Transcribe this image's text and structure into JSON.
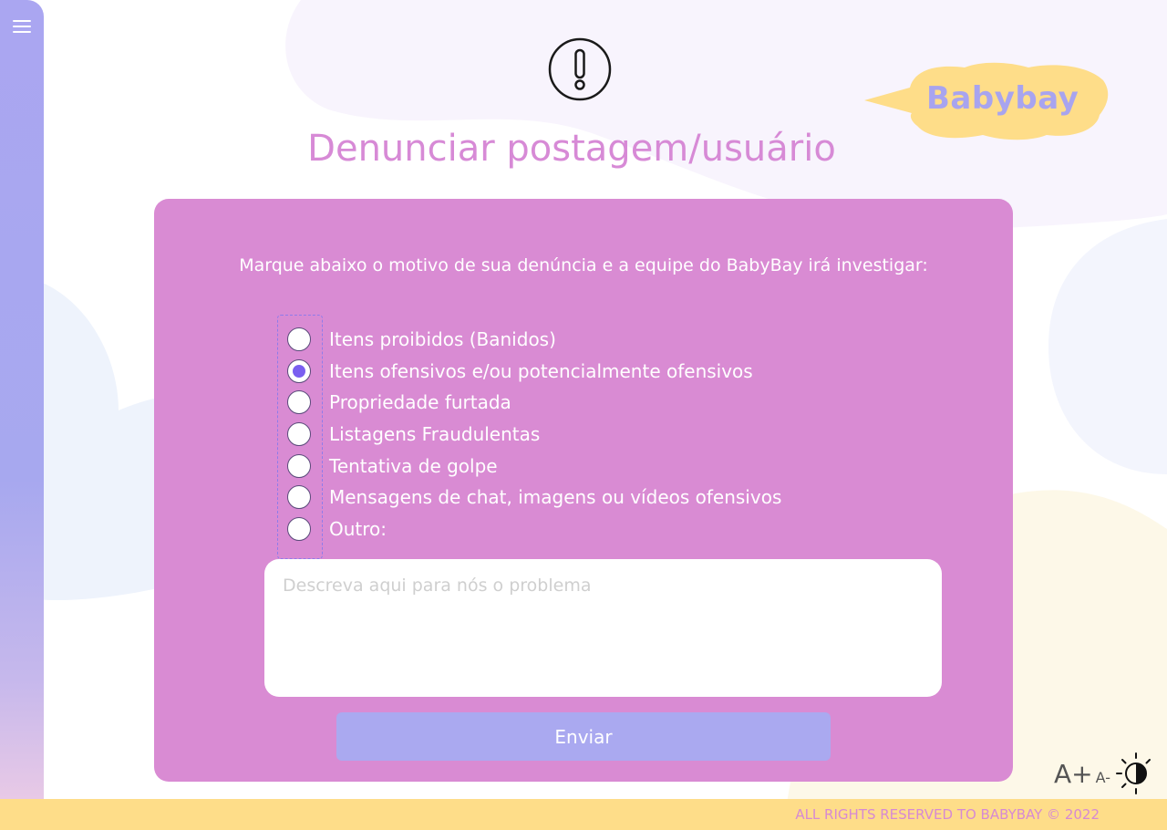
{
  "sidebar": {
    "menu_icon": "hamburger-menu-icon"
  },
  "header": {
    "alert_icon": "exclamation-circle-icon",
    "title": "Denunciar postagem/usuário",
    "logo_text": "Babybay"
  },
  "form": {
    "intro": "Marque abaixo o motivo de sua denúncia e a equipe do BabyBay irá investigar:",
    "options": [
      {
        "label": "Itens proibidos (Banidos)",
        "checked": false
      },
      {
        "label": "Itens ofensivos e/ou potencialmente ofensivos",
        "checked": true
      },
      {
        "label": "Propriedade furtada",
        "checked": false
      },
      {
        "label": "Listagens Fraudulentas",
        "checked": false
      },
      {
        "label": "Tentativa de golpe",
        "checked": false
      },
      {
        "label": "Mensagens de chat, imagens ou vídeos ofensivos",
        "checked": false
      },
      {
        "label": "Outro:",
        "checked": false
      }
    ],
    "description_placeholder": "Descreva aqui para nós o problema",
    "description_value": "",
    "submit_label": "Enviar"
  },
  "accessibility": {
    "increase_label": "A+",
    "decrease_label": "A-",
    "contrast_icon": "contrast-toggle-icon"
  },
  "footer": {
    "text": "ALL RIGHTS RESERVED TO BABYBAY © 2022"
  },
  "colors": {
    "primary": "#d98bd3",
    "accent": "#aaa9f0",
    "logo_bg": "#fedd89",
    "title": "#d78ad6"
  }
}
